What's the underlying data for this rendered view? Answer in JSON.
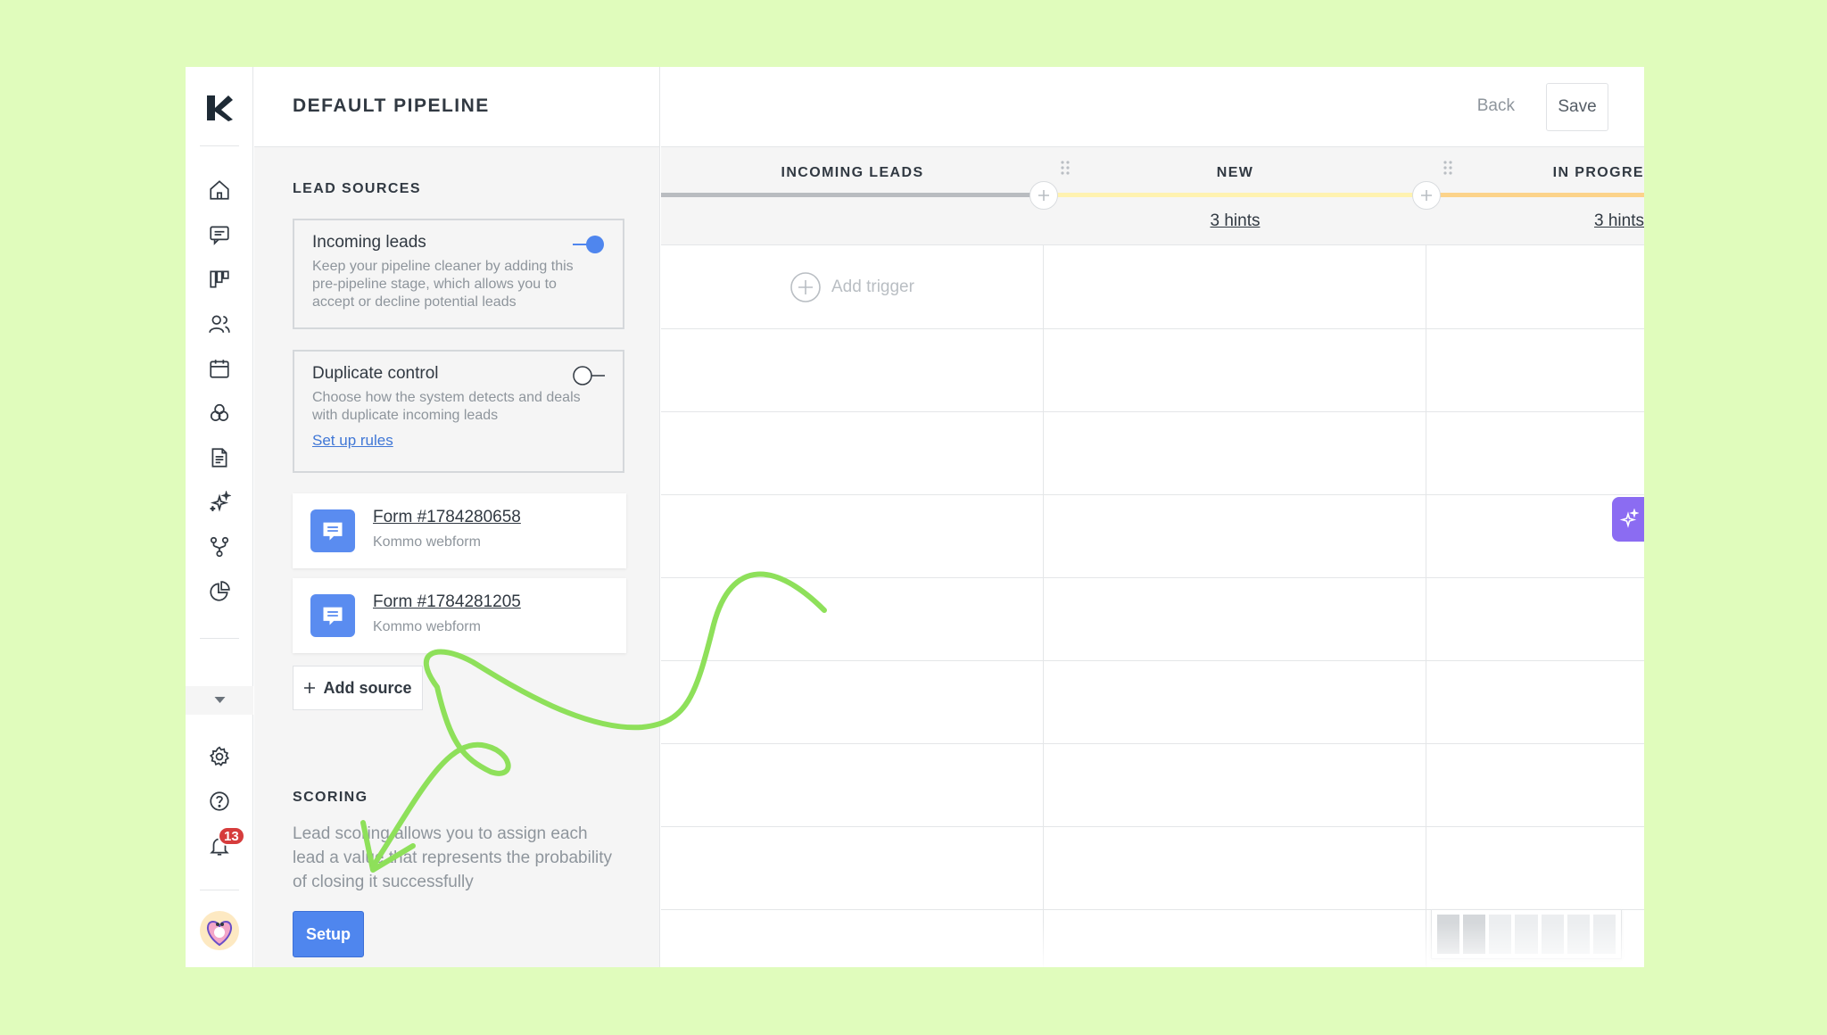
{
  "header": {
    "title": "DEFAULT PIPELINE",
    "back_label": "Back",
    "save_label": "Save"
  },
  "nav": {
    "items": [
      "home-icon",
      "chats-icon",
      "leads-icon",
      "contacts-icon",
      "calendar-icon",
      "lists-icon",
      "documents-icon",
      "ai-sparkle-icon",
      "integrations-icon",
      "reports-icon"
    ],
    "settings": "gear-icon",
    "help": "help-icon",
    "notifications": {
      "icon": "bell-icon",
      "count": "13"
    }
  },
  "lead_sources": {
    "title": "LEAD SOURCES",
    "incoming": {
      "title": "Incoming leads",
      "description": "Keep your pipeline cleaner by adding this pre-pipeline stage, which allows you to accept or decline potential leads",
      "enabled": true
    },
    "duplicate": {
      "title": "Duplicate control",
      "description": "Choose how the system detects and deals with duplicate incoming leads",
      "link": "Set up rules",
      "enabled": false
    },
    "forms": [
      {
        "title": "Form #1784280658",
        "subtitle": "Kommo webform"
      },
      {
        "title": "Form #1784281205",
        "subtitle": "Kommo webform"
      }
    ],
    "add_source_label": "Add source"
  },
  "scoring": {
    "title": "SCORING",
    "description": "Lead scoring allows you to assign each lead a value that represents the probability of closing it successfully",
    "setup_label": "Setup"
  },
  "board": {
    "stages": [
      {
        "name": "INCOMING LEADS",
        "color": "#b9bcc0",
        "hints": ""
      },
      {
        "name": "NEW",
        "color": "#fff2b0",
        "hints": "3 hints"
      },
      {
        "name": "IN PROGRE",
        "color": "#fcd38a",
        "hints": "3 hints"
      }
    ],
    "add_trigger_label": "Add trigger"
  },
  "colors": {
    "accent": "#4f86ee",
    "background": "#e0fcbc",
    "scribble": "#8ee05a",
    "ai": "#8b6cf2",
    "badge": "#d63c3c"
  }
}
